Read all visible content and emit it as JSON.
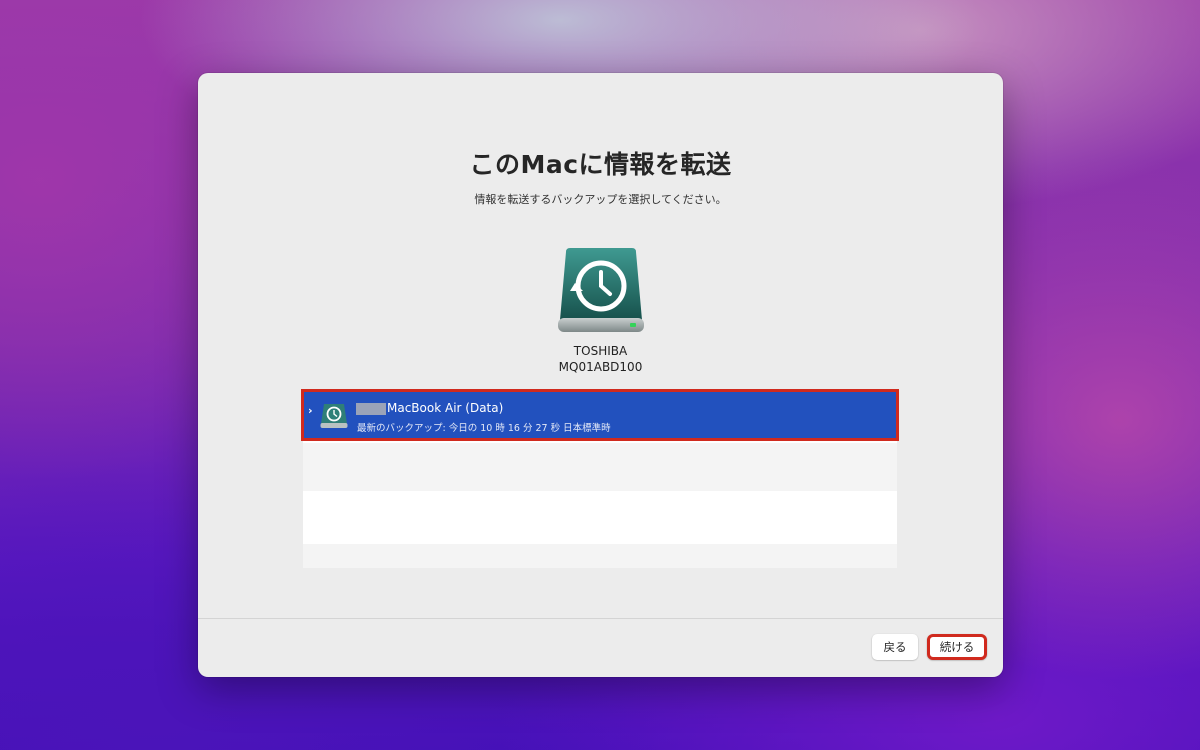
{
  "dialog": {
    "title": "このMacに情報を転送",
    "subtitle": "情報を転送するバックアップを選択してください。"
  },
  "drive": {
    "icon": "time-machine-drive-icon",
    "name_line1": "TOSHIBA",
    "name_line2": "MQ01ABD100"
  },
  "backup_list": {
    "items": [
      {
        "title": "MacBook Air (Data)",
        "subtitle": "最新のバックアップ: 今日の 10 時 16 分 27 秒 日本標準時",
        "selected": true,
        "icon": "time-machine-drive-icon"
      }
    ]
  },
  "buttons": {
    "back": "戻る",
    "continue": "続ける"
  },
  "colors": {
    "selection": "#2251be",
    "highlight_border": "#d02a1e",
    "drive_teal": "#2f7f78"
  }
}
